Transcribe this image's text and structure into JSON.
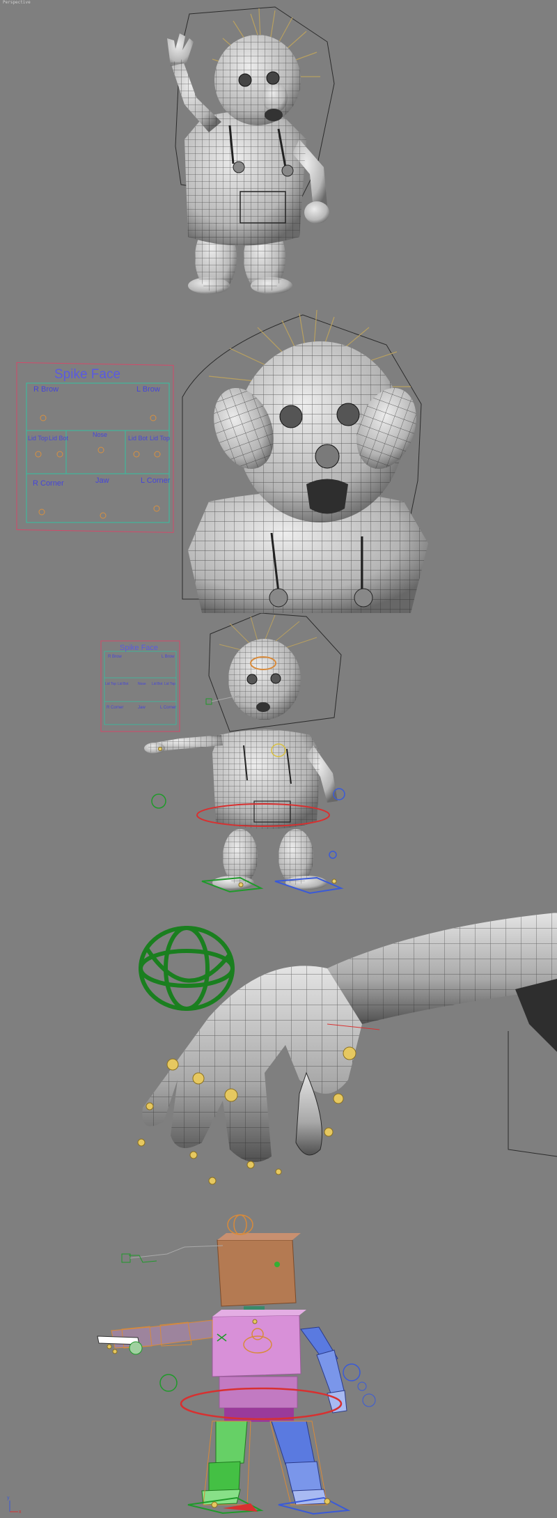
{
  "viewport": {
    "corner_label": "Perspective"
  },
  "panels": [
    {
      "name": "model-waving"
    },
    {
      "name": "model-face-rig"
    },
    {
      "name": "model-full-rig"
    },
    {
      "name": "hand-closeup"
    },
    {
      "name": "proxy-skeleton"
    }
  ],
  "face_panel_large": {
    "title": "Spike Face",
    "labels": [
      "R Brow",
      "L Brow",
      "Lid Top",
      "Lid Bot",
      "Nose",
      "Lid Bot",
      "Lid Top",
      "R Corner",
      "Jaw",
      "L Corner"
    ]
  },
  "face_panel_small": {
    "title": "Spike Face",
    "labels": [
      "R Brow",
      "L Brow",
      "Lid Top",
      "Lid Bot",
      "Nose",
      "Lid Bot",
      "Lid Top",
      "R Corner",
      "Jaw",
      "L Corner"
    ]
  },
  "axis": {
    "x": "x",
    "y": "y"
  },
  "colors": {
    "background": "#7f7f7f",
    "mesh": "#d8d8d8",
    "wire": "#2a2a2a",
    "spikes": "#b8a060",
    "face_panel_text": "#4646d8",
    "face_panel_border": "#d24a6a",
    "face_panel_grid": "#33c0a0",
    "control_green": "#1f9a2a",
    "control_blue": "#3a5ad8",
    "control_red": "#d83030",
    "control_orange": "#d88a3a",
    "proxy_pink": "#d890d8",
    "proxy_brown": "#b47a52"
  }
}
